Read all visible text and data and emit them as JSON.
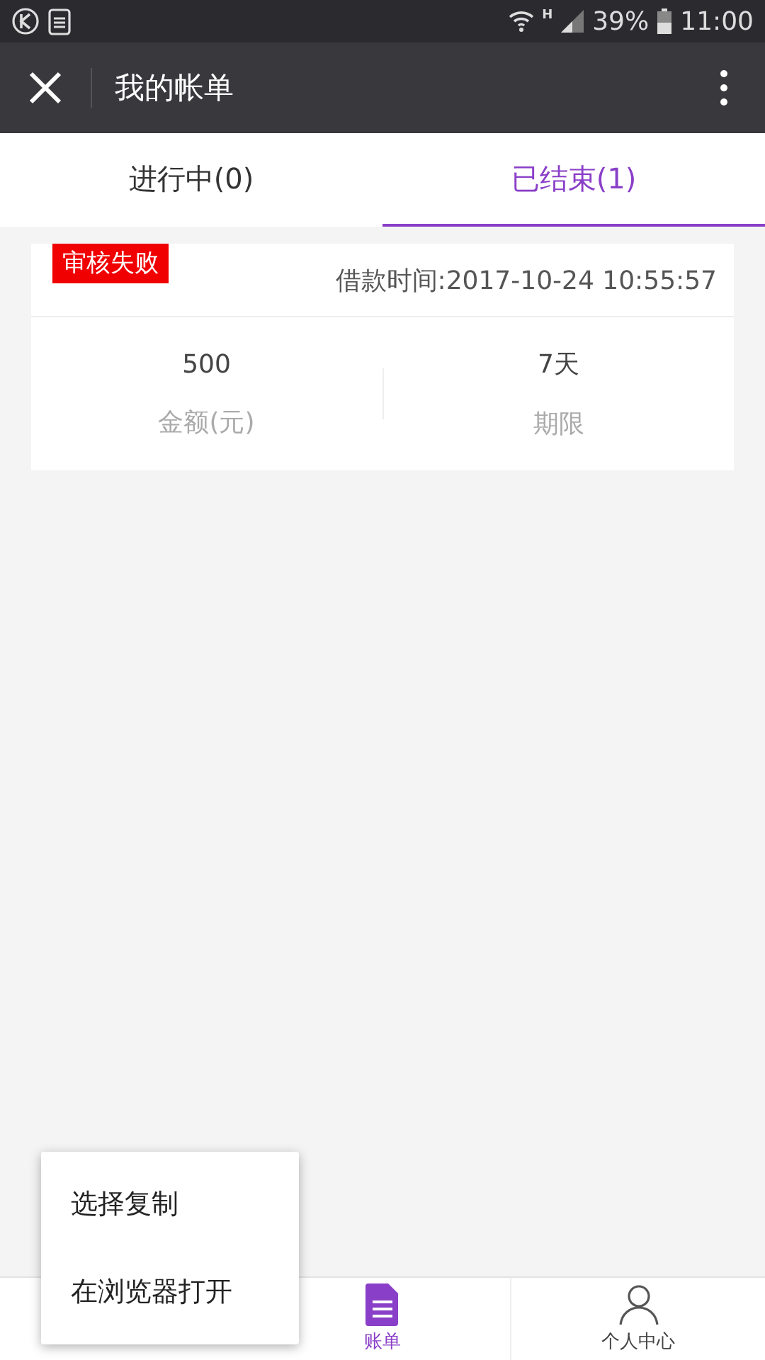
{
  "status_bar": {
    "network": "H",
    "battery": "39%",
    "time": "11:00"
  },
  "header": {
    "title": "我的帐单"
  },
  "tabs": [
    {
      "label": "进行中(0)",
      "selected": false
    },
    {
      "label": "已结束(1)",
      "selected": true
    }
  ],
  "bills": [
    {
      "status": "审核失败",
      "time": "借款时间:2017-10-24 10:55:57",
      "amount": "500",
      "amount_label": "金额(元)",
      "term": "7天",
      "term_label": "期限"
    }
  ],
  "bottom_nav": [
    {
      "label": "账单",
      "kind": "document",
      "selected": true
    },
    {
      "label": "个人中心",
      "kind": "person",
      "selected": false
    }
  ],
  "popup_menu": [
    "选择复制",
    "在浏览器打开"
  ]
}
